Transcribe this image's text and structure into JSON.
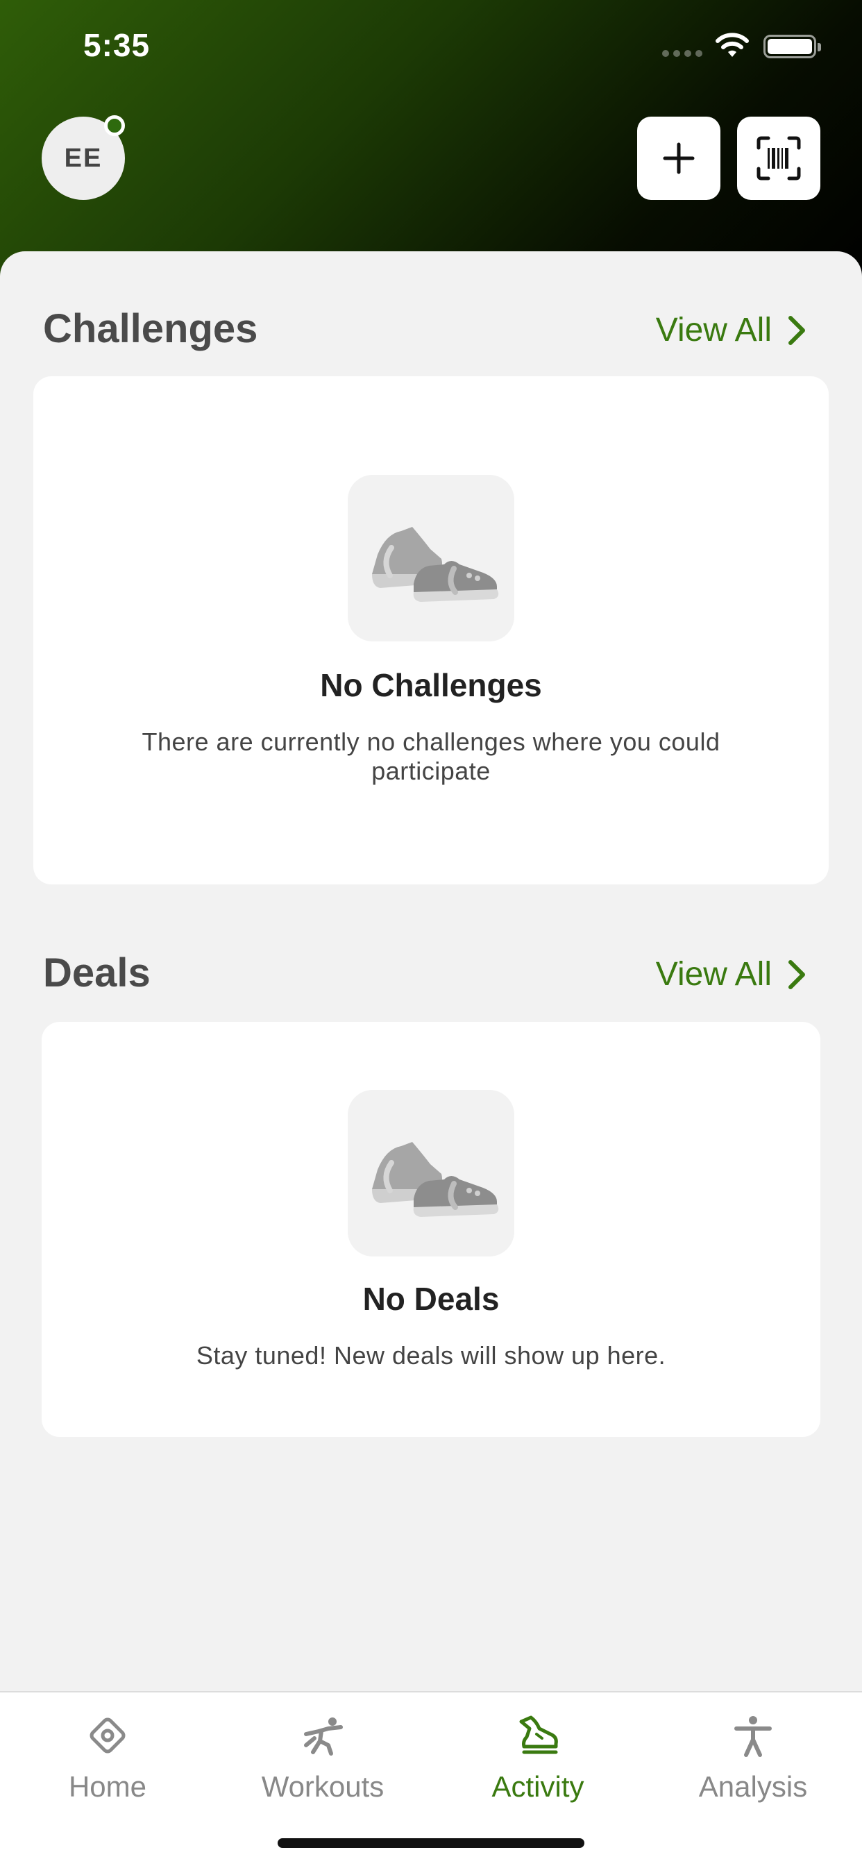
{
  "status_bar": {
    "time": "5:35"
  },
  "header": {
    "avatar_initials": "EE"
  },
  "challenges": {
    "title": "Challenges",
    "view_all": "View All",
    "empty_title": "No Challenges",
    "empty_text": "There are currently no challenges where you could participate"
  },
  "deals": {
    "title": "Deals",
    "view_all": "View All",
    "empty_title": "No Deals",
    "empty_text": "Stay tuned! New deals will show up here."
  },
  "tabbar": {
    "items": [
      {
        "label": "Home",
        "icon": "home-icon",
        "active": false
      },
      {
        "label": "Workouts",
        "icon": "workouts-icon",
        "active": false
      },
      {
        "label": "Activity",
        "icon": "activity-icon",
        "active": true
      },
      {
        "label": "Analysis",
        "icon": "analysis-icon",
        "active": false
      }
    ]
  },
  "colors": {
    "accent": "#3a7a10",
    "header_start": "#2f5d08",
    "header_end": "#000000",
    "background": "#f2f2f2"
  }
}
